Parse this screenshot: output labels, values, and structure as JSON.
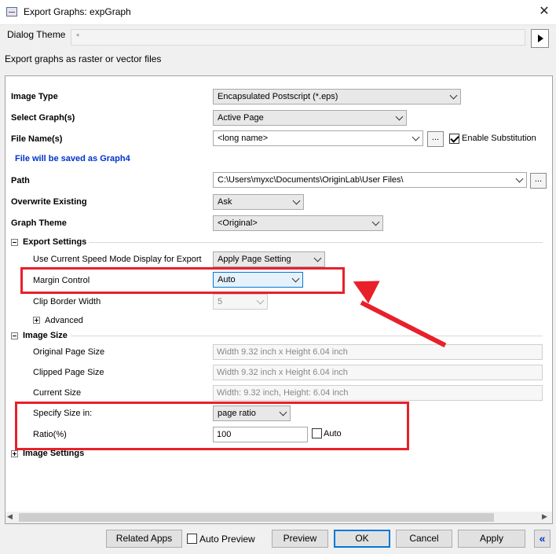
{
  "window": {
    "title": "Export Graphs: expGraph",
    "close_glyph": "✕"
  },
  "dialog_theme": {
    "label": "Dialog Theme",
    "value": "*"
  },
  "description": "Export graphs as raster or vector files",
  "fields": {
    "image_type": {
      "label": "Image Type",
      "value": "Encapsulated Postscript (*.eps)"
    },
    "select_graphs": {
      "label": "Select Graph(s)",
      "value": "Active Page"
    },
    "file_name": {
      "label": "File Name(s)",
      "value": "<long name>",
      "browse": "...",
      "enable_substitution": "Enable Substitution",
      "enable_substitution_checked": true
    },
    "save_note": "File will be saved as Graph4",
    "path": {
      "label": "Path",
      "value": "C:\\Users\\myxc\\Documents\\OriginLab\\User Files\\",
      "browse": "..."
    },
    "overwrite": {
      "label": "Overwrite Existing",
      "value": "Ask"
    },
    "graph_theme": {
      "label": "Graph Theme",
      "value": "<Original>"
    }
  },
  "export_settings": {
    "header": "Export Settings",
    "speed_mode": {
      "label": "Use Current Speed Mode Display for Export",
      "value": "Apply Page Setting"
    },
    "margin_control": {
      "label": "Margin Control",
      "value": "Auto"
    },
    "clip_border": {
      "label": "Clip Border Width",
      "value": "5"
    },
    "advanced": "Advanced"
  },
  "image_size": {
    "header": "Image Size",
    "original": {
      "label": "Original Page Size",
      "value": "Width 9.32 inch x Height 6.04 inch"
    },
    "clipped": {
      "label": "Clipped Page Size",
      "value": "Width 9.32 inch x Height 6.04 inch"
    },
    "current": {
      "label": "Current Size",
      "value": "Width: 9.32 inch, Height: 6.04 inch"
    },
    "specify": {
      "label": "Specify Size in:",
      "value": "page ratio"
    },
    "ratio": {
      "label": "Ratio(%)",
      "value": "100",
      "auto": "Auto",
      "auto_checked": false
    }
  },
  "image_settings": {
    "header": "Image Settings"
  },
  "buttons": {
    "related_apps": "Related Apps",
    "auto_preview": "Auto Preview",
    "preview": "Preview",
    "ok": "OK",
    "cancel": "Cancel",
    "apply": "Apply",
    "collapse": "«"
  },
  "colors": {
    "annotation": "#e8202a",
    "note": "#0033cc",
    "focus": "#0078d7"
  }
}
